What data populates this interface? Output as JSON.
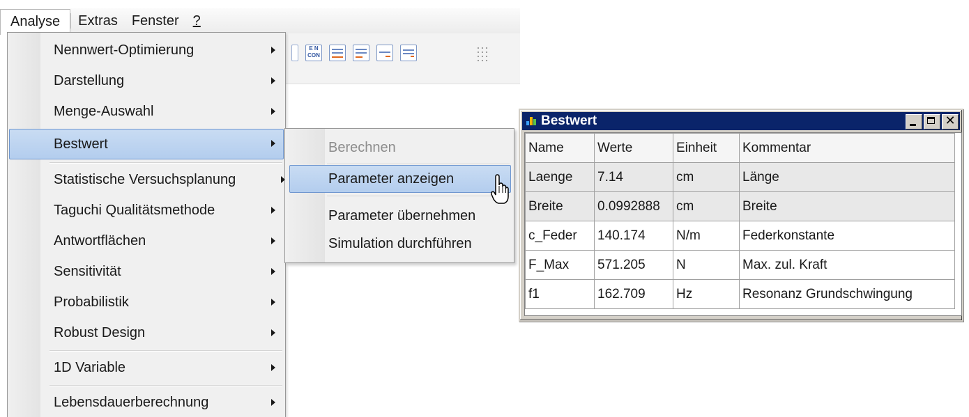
{
  "menubar": {
    "items": [
      {
        "label": "Analyse"
      },
      {
        "label": "Extras"
      },
      {
        "label": "Fenster"
      },
      {
        "label": "?"
      }
    ]
  },
  "menu": {
    "items": [
      {
        "label": "Nennwert-Optimierung",
        "has_submenu": true
      },
      {
        "label": "Darstellung",
        "has_submenu": true
      },
      {
        "label": "Menge-Auswahl",
        "has_submenu": true
      },
      {
        "label": "Bestwert",
        "has_submenu": true,
        "highlighted": true
      },
      {
        "label": "Statistische Versuchsplanung",
        "has_submenu": true
      },
      {
        "label": "Taguchi Qualitätsmethode",
        "has_submenu": true
      },
      {
        "label": "Antwortflächen",
        "has_submenu": true
      },
      {
        "label": "Sensitivität",
        "has_submenu": true
      },
      {
        "label": "Probabilistik",
        "has_submenu": true
      },
      {
        "label": "Robust Design",
        "has_submenu": true
      },
      {
        "label": "1D Variable",
        "has_submenu": true
      },
      {
        "label": "Lebensdauerberechnung",
        "has_submenu": true
      }
    ]
  },
  "submenu": {
    "items": [
      {
        "label": "Berechnen",
        "disabled": true
      },
      {
        "label": "Parameter anzeigen",
        "highlighted": true
      },
      {
        "label": "Parameter übernehmen"
      },
      {
        "label": "Simulation durchführen"
      }
    ]
  },
  "window": {
    "title": "Bestwert",
    "columns": [
      "Name",
      "Werte",
      "Einheit",
      "Kommentar"
    ],
    "rows": [
      [
        "Laenge",
        "7.14",
        "cm",
        "Länge"
      ],
      [
        "Breite",
        "0.0992888",
        "cm",
        "Breite"
      ],
      [
        "c_Feder",
        "140.174",
        "N/m",
        "Federkonstante"
      ],
      [
        "F_Max",
        "571.205",
        "N",
        "Max. zul. Kraft"
      ],
      [
        "f1",
        "162.709",
        "Hz",
        "Resonanz Grundschwingung"
      ]
    ]
  },
  "colors": {
    "highlight": "#b3cdee",
    "title_bar": "#0a246a"
  }
}
